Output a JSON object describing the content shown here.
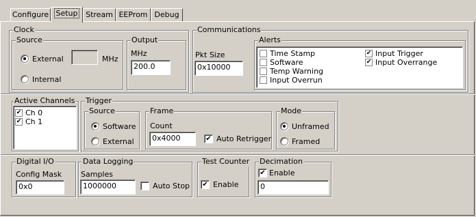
{
  "tabs": [
    {
      "label": "Configure",
      "active": false
    },
    {
      "label": "Setup",
      "active": true
    },
    {
      "label": "Stream",
      "active": false
    },
    {
      "label": "EEProm",
      "active": false
    },
    {
      "label": "Debug",
      "active": false
    }
  ],
  "clock": {
    "title": "Clock",
    "source": {
      "title": "Source",
      "external_label": "External",
      "internal_label": "Internal",
      "selected": "External",
      "mhz_value": "",
      "mhz_unit": "MHz"
    },
    "output": {
      "title": "Output",
      "unit_label": "MHz",
      "value": "200.0"
    }
  },
  "communications": {
    "title": "Communications",
    "pkt_size_label": "Pkt Size",
    "pkt_size_value": "0x10000"
  },
  "alerts": {
    "title": "Alerts",
    "items": [
      {
        "label": "Time Stamp",
        "checked": false
      },
      {
        "label": "Software",
        "checked": false
      },
      {
        "label": "Temp Warning",
        "checked": false
      },
      {
        "label": "Input Overrun",
        "checked": false
      },
      {
        "label": "Input Trigger",
        "checked": true
      },
      {
        "label": "Input Overrange",
        "checked": true
      }
    ]
  },
  "active_channels": {
    "title": "Active Channels",
    "items": [
      {
        "label": "Ch 0",
        "checked": true
      },
      {
        "label": "Ch 1",
        "checked": true
      }
    ]
  },
  "trigger": {
    "title": "Trigger",
    "source": {
      "title": "Source",
      "software_label": "Software",
      "external_label": "External",
      "selected": "Software"
    },
    "frame": {
      "title": "Frame",
      "count_label": "Count",
      "count_value": "0x4000",
      "auto_retrigger_label": "Auto Retrigger",
      "auto_retrigger": true
    },
    "mode": {
      "title": "Mode",
      "unframed_label": "Unframed",
      "framed_label": "Framed",
      "selected": "Unframed"
    }
  },
  "digital_io": {
    "title": "Digital I/O",
    "config_mask_label": "Config Mask",
    "config_mask_value": "0x0"
  },
  "data_logging": {
    "title": "Data Logging",
    "samples_label": "Samples",
    "samples_value": "1000000",
    "auto_stop_label": "Auto Stop",
    "auto_stop": false
  },
  "test_counter": {
    "title": "Test Counter",
    "enable_label": "Enable",
    "enable": true
  },
  "decimation": {
    "title": "Decimation",
    "enable_label": "Enable",
    "enable": true,
    "value": "0"
  }
}
